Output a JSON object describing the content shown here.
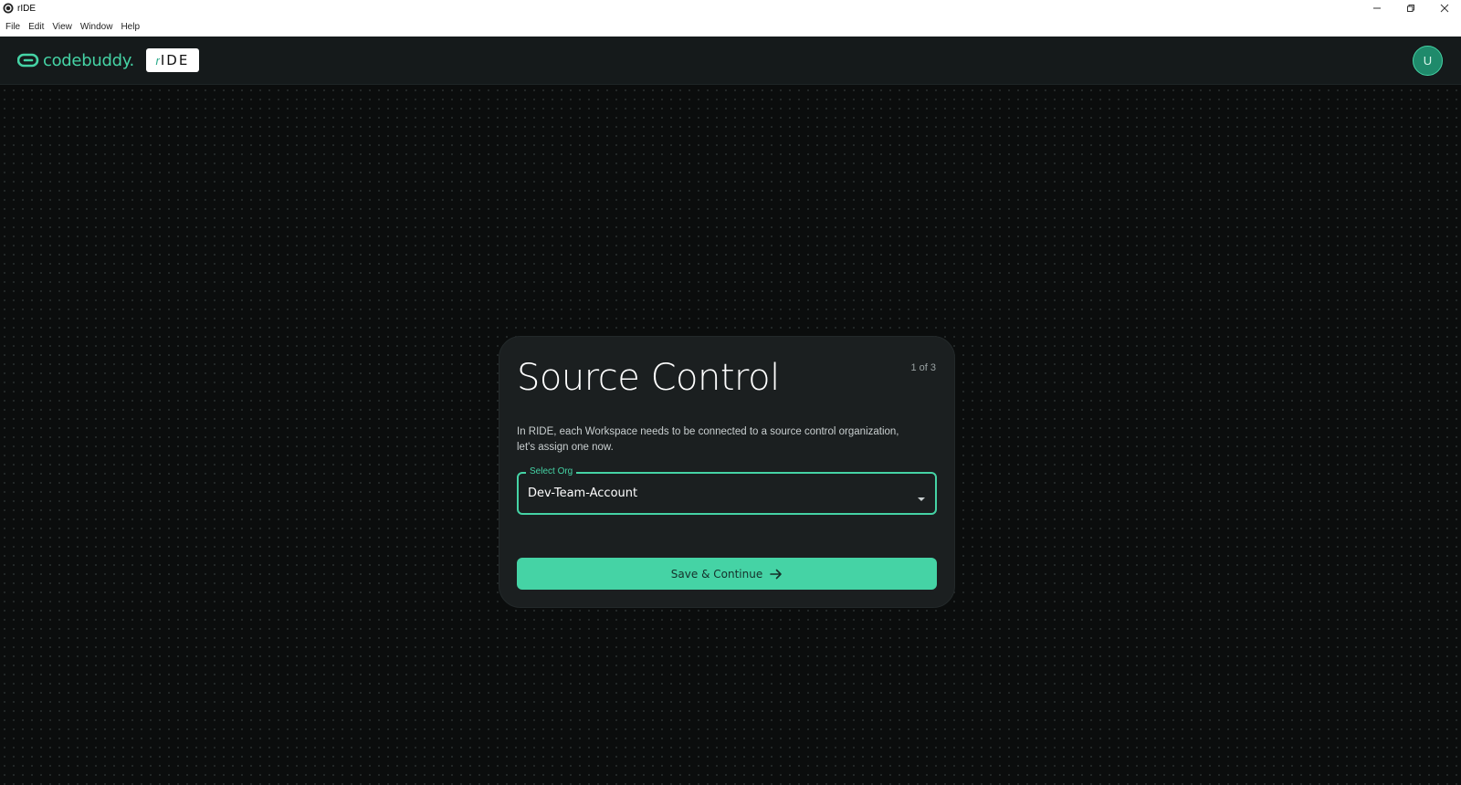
{
  "window": {
    "title": "rIDE",
    "controls": [
      "minimize-icon",
      "restore-icon",
      "close-icon"
    ]
  },
  "menubar": {
    "items": [
      {
        "label": "File"
      },
      {
        "label": "Edit"
      },
      {
        "label": "View"
      },
      {
        "label": "Window"
      },
      {
        "label": "Help"
      }
    ]
  },
  "header": {
    "brand_name": "codebuddy.",
    "badge_r": "r",
    "badge_text": "IDE",
    "avatar_initial": "U"
  },
  "card": {
    "title": "Source Control",
    "step": "1 of 3",
    "description": "In RIDE, each Workspace needs to be connected to a source control organization, let's assign one now.",
    "select_label": "Select Org",
    "select_value": "Dev-Team-Account",
    "button_label": "Save & Continue"
  },
  "colors": {
    "accent": "#45d3a5",
    "header_bg": "#151a1b",
    "card_bg": "#1b1f20",
    "canvas_bg": "#0b0d0d"
  }
}
